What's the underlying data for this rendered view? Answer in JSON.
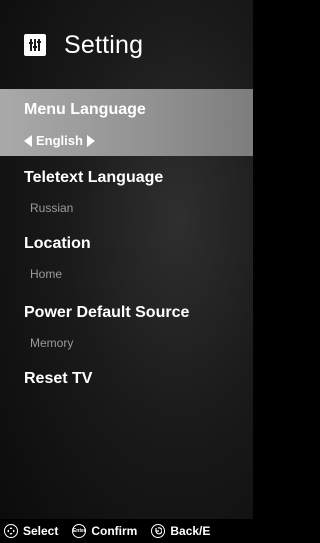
{
  "header": {
    "title": "Setting",
    "icon": "settings-sliders-icon"
  },
  "menu": {
    "items": [
      {
        "label": "Menu Language",
        "value": "English"
      },
      {
        "label": "Teletext Language",
        "value": "Russian"
      },
      {
        "label": "Location",
        "value": "Home"
      },
      {
        "label": "Power Default Source",
        "value": "Memory"
      },
      {
        "label": "Reset TV"
      }
    ]
  },
  "footer": {
    "select_label": "Select",
    "confirm_label": "Confirm",
    "confirm_icon_text": "Enter",
    "back_label": "Back/E"
  },
  "colors": {
    "selected_bar": "#a0a0a0",
    "background": "#1a1a1a",
    "secondary_text": "#9a9a9a"
  }
}
